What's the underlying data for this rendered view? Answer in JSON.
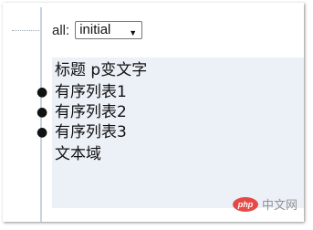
{
  "control": {
    "label": "all:",
    "selected_value": "initial"
  },
  "content": {
    "heading": "标题 p变文字",
    "list_items": [
      "有序列表1",
      "有序列表2",
      "有序列表3"
    ],
    "textarea_label": "文本域",
    "background": "#ecf0f7"
  },
  "watermark": {
    "logo_text": "php",
    "site_text": "中文网"
  }
}
